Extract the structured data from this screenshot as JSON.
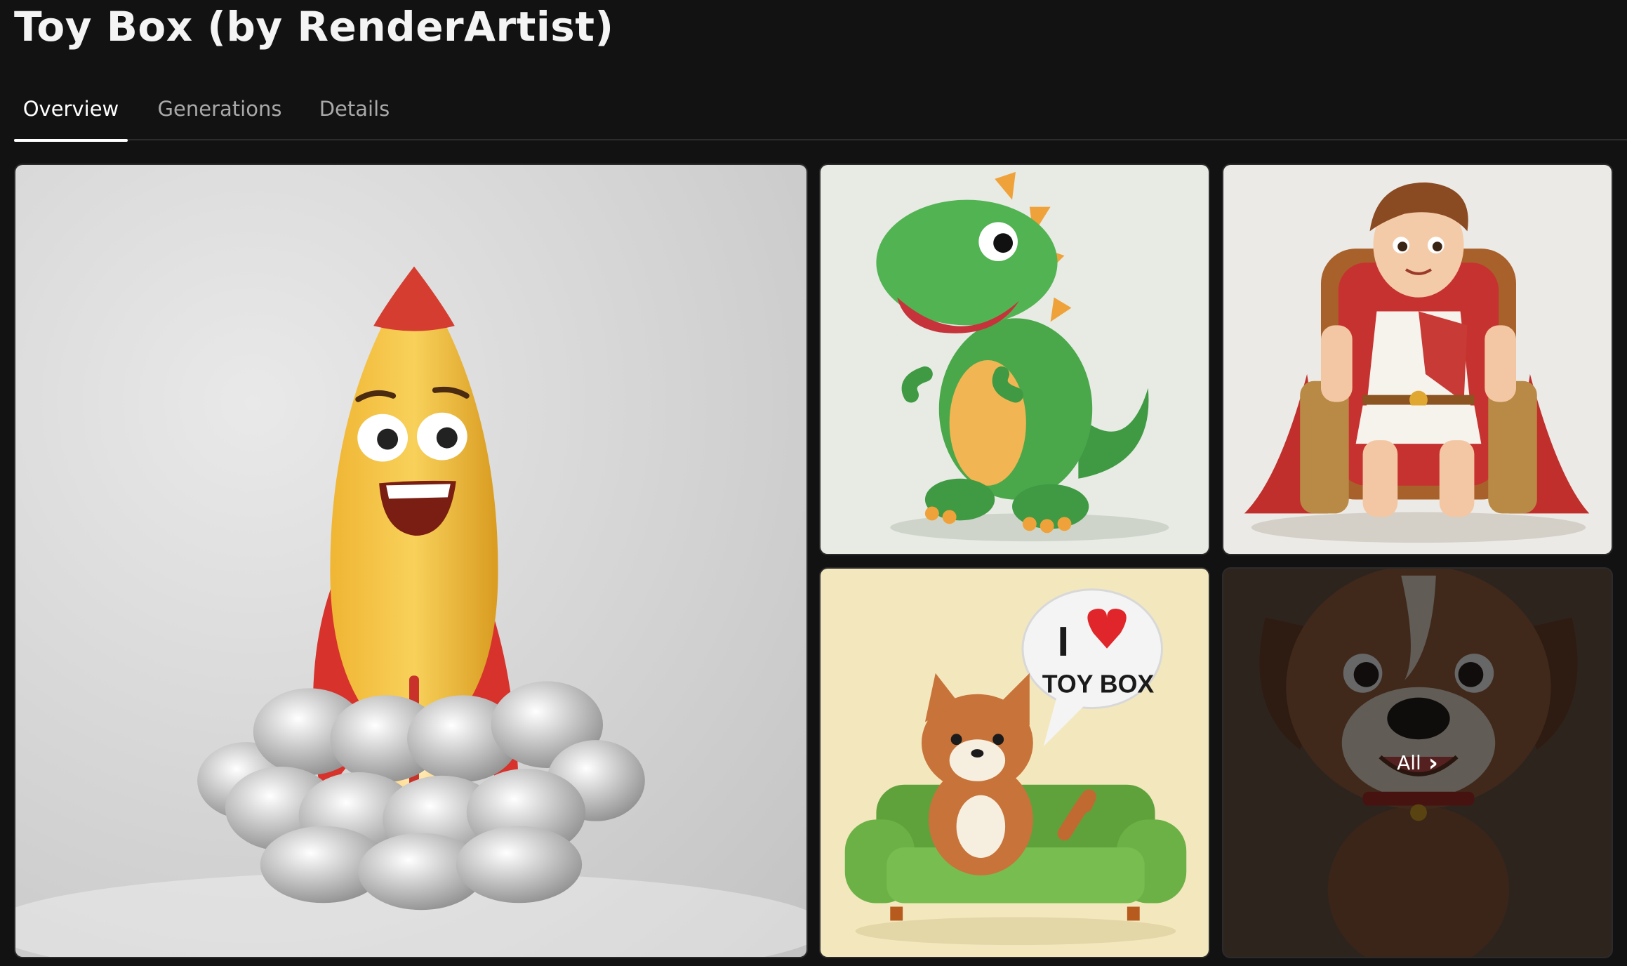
{
  "page": {
    "title": "Toy Box (by RenderArtist)"
  },
  "tabs": [
    {
      "label": "Overview",
      "active": true
    },
    {
      "label": "Generations",
      "active": false
    },
    {
      "label": "Details",
      "active": false
    }
  ],
  "gallery": {
    "images": [
      {
        "subject": "rocket-toy"
      },
      {
        "subject": "dinosaur-toy"
      },
      {
        "subject": "boy-on-throne-toy"
      },
      {
        "subject": "cat-on-sofa-toy",
        "bubble_text_top": "I",
        "bubble_text_bottom": "TOY BOX"
      },
      {
        "subject": "dog-toy"
      }
    ],
    "all_button": {
      "label": "All",
      "icon": "chevron-right-icon"
    }
  },
  "colors": {
    "background": "#121212",
    "active_tab": "#ffffff",
    "inactive_tab": "#a9a9a9"
  }
}
